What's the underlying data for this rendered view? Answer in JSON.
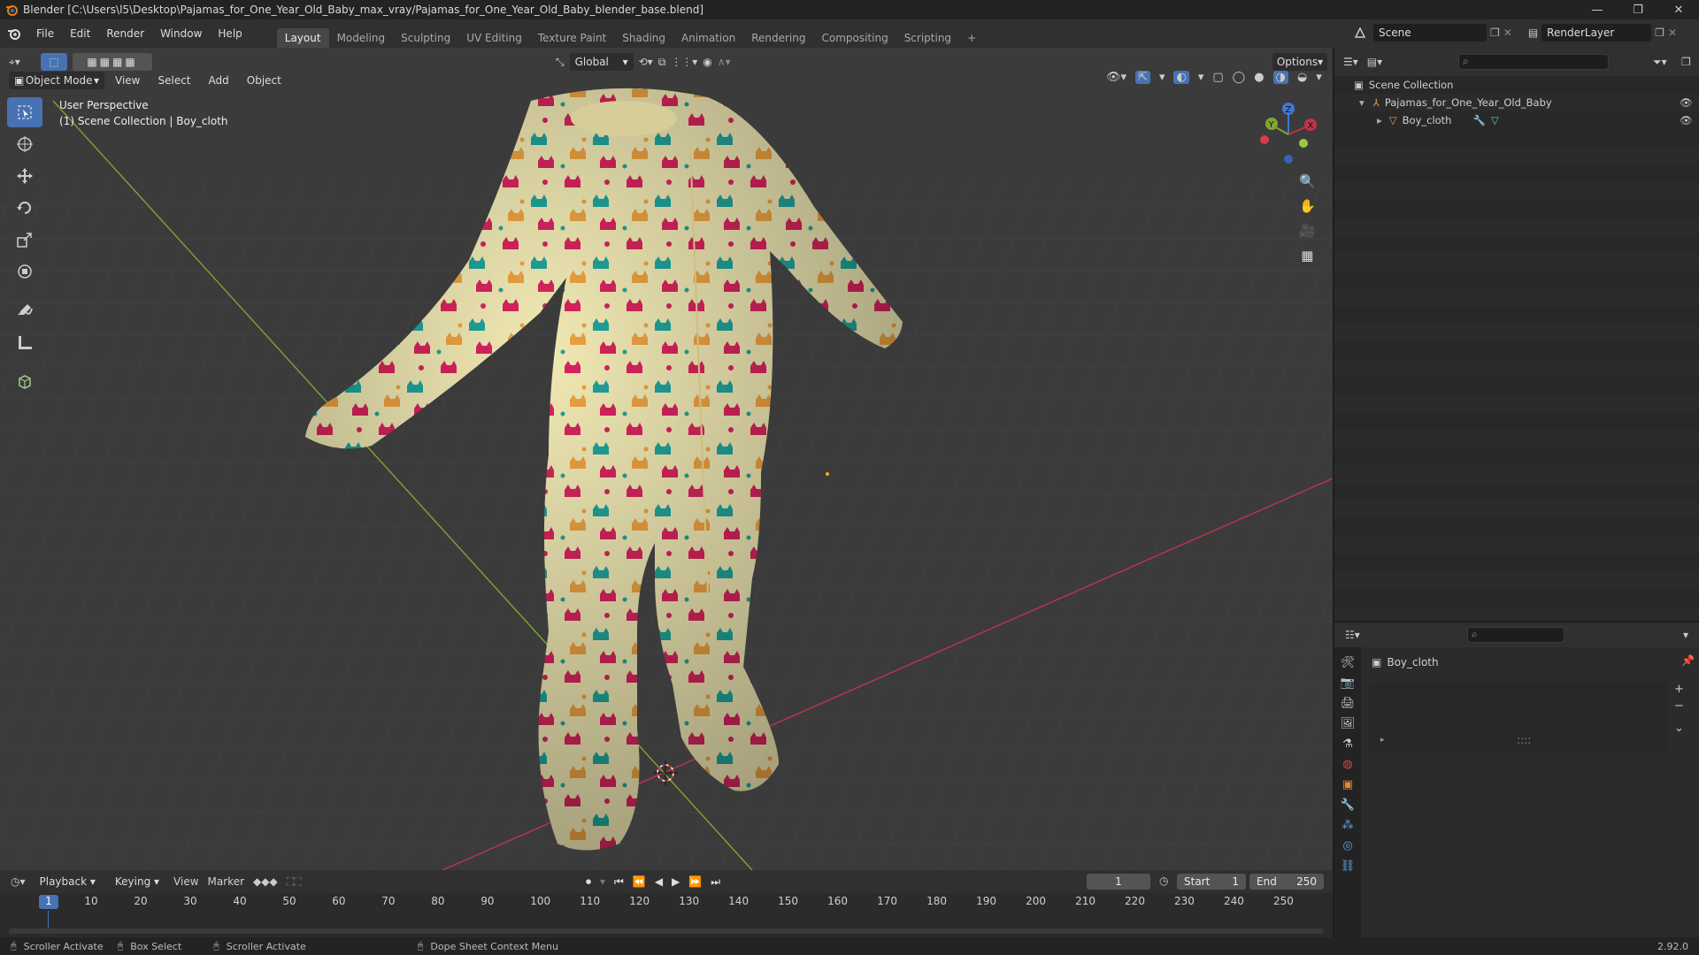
{
  "window": {
    "title": "Blender [C:\\Users\\l5\\Desktop\\Pajamas_for_One_Year_Old_Baby_max_vray/Pajamas_for_One_Year_Old_Baby_blender_base.blend]",
    "minimize": "—",
    "restore": "❐",
    "close": "✕"
  },
  "menu": [
    "File",
    "Edit",
    "Render",
    "Window",
    "Help"
  ],
  "workspaces": [
    "Layout",
    "Modeling",
    "Sculpting",
    "UV Editing",
    "Texture Paint",
    "Shading",
    "Animation",
    "Rendering",
    "Compositing",
    "Scripting"
  ],
  "workspace_add": "+",
  "scene_name": "Scene",
  "render_layer": "RenderLayer",
  "viewport": {
    "mode": "Object Mode",
    "menu": [
      "View",
      "Select",
      "Add",
      "Object"
    ],
    "orientation": "Global",
    "options_label": "Options",
    "overlay_line1": "User Perspective",
    "overlay_line2": "(1) Scene Collection | Boy_cloth",
    "gizmo_axes": {
      "x": "X",
      "y": "Y",
      "z": "Z"
    }
  },
  "outliner": {
    "root": "Scene Collection",
    "collection": "Pajamas_for_One_Year_Old_Baby",
    "object": "Boy_cloth"
  },
  "properties": {
    "object_name": "Boy_cloth",
    "handle": "::::"
  },
  "timeline": {
    "menu": [
      "Playback",
      "Keying",
      "View",
      "Marker"
    ],
    "current_frame": "1",
    "start_label": "Start",
    "start_value": "1",
    "end_label": "End",
    "end_value": "250",
    "ruler": [
      "1",
      "10",
      "20",
      "30",
      "40",
      "50",
      "60",
      "70",
      "80",
      "90",
      "100",
      "110",
      "120",
      "130",
      "140",
      "150",
      "160",
      "170",
      "180",
      "190",
      "200",
      "210",
      "220",
      "230",
      "240",
      "250"
    ]
  },
  "status": {
    "item1": "Scroller Activate",
    "item2": "Box Select",
    "item3": "Scroller Activate",
    "item4": "Dope Sheet Context Menu",
    "version": "2.92.0"
  },
  "colors": {
    "accent": "#4772b3",
    "pajama_base": "#f1e9b4",
    "pattern_pink": "#d8245e",
    "pattern_teal": "#1fa49b",
    "pattern_orange": "#eea240",
    "axis_x": "#c1334b",
    "axis_y": "#7fa531"
  }
}
